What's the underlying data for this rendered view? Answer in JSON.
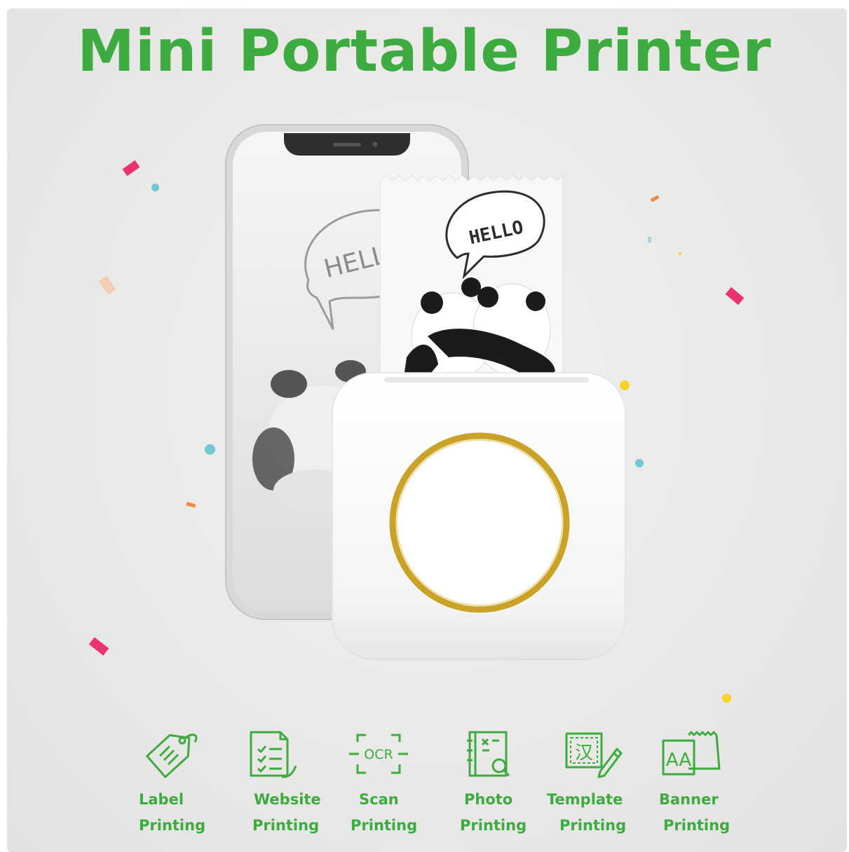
{
  "title": "Mini Portable Printer",
  "colors": {
    "accent_green": "#3dab3f",
    "background": "#e9e9e7",
    "ring_gold": "#c9a227",
    "confetti_pink": "#e8336e",
    "confetti_cyan": "#6fc8d2",
    "confetti_yellow": "#f5d22c",
    "confetti_orange": "#f08a3c"
  },
  "paper_text": "HELLO",
  "phone_screen_text": "HELL",
  "features": [
    {
      "icon": "label-tag-icon",
      "line1": "Label",
      "line2": "Printing"
    },
    {
      "icon": "website-document-icon",
      "line1": "Website",
      "line2": "Printing"
    },
    {
      "icon": "ocr-scan-icon",
      "icon_text": "OCR",
      "line1": "Scan",
      "line2": "Printing"
    },
    {
      "icon": "photo-album-icon",
      "line1": "Photo",
      "line2": "Printing"
    },
    {
      "icon": "template-edit-icon",
      "icon_text": "汉",
      "line1": "Template",
      "line2": "Printing"
    },
    {
      "icon": "banner-letters-icon",
      "icon_text": "AA",
      "line1": "Banner",
      "line2": "Printing"
    }
  ]
}
